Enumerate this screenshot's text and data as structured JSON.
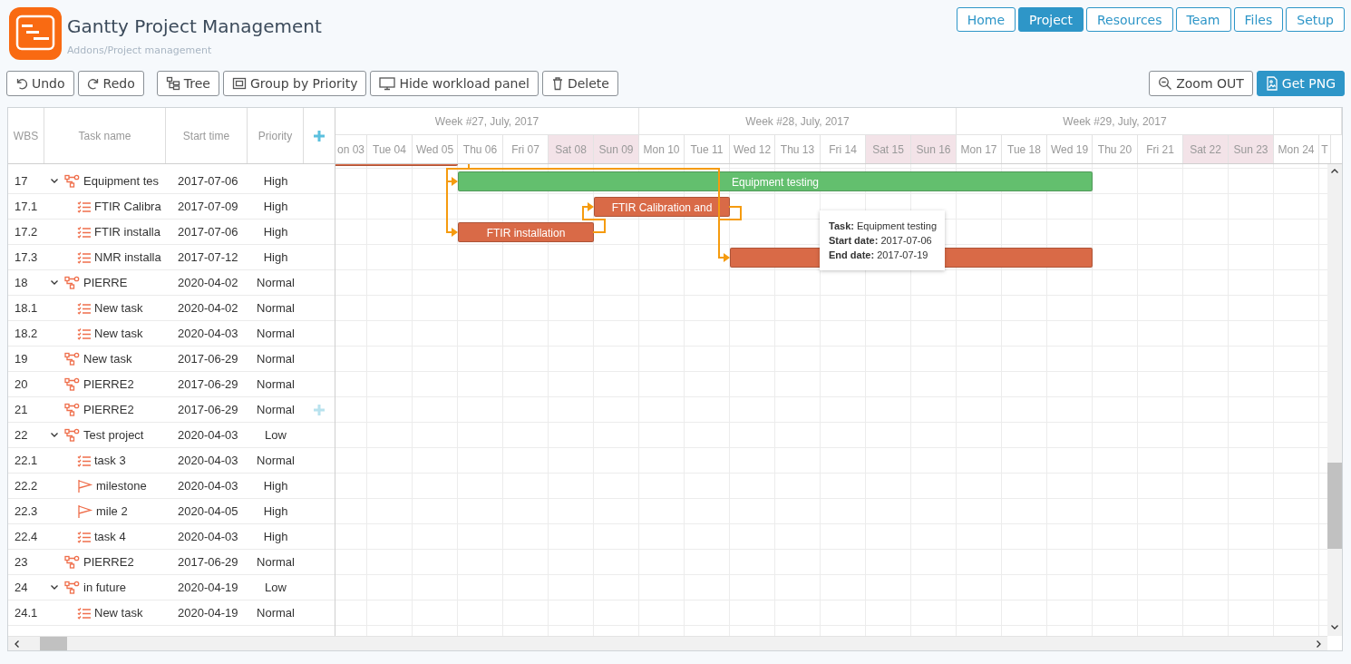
{
  "app": {
    "title": "Gantty Project Management",
    "breadcrumb": "Addons/Project management"
  },
  "nav": [
    {
      "label": "Home",
      "selected": false
    },
    {
      "label": "Project",
      "selected": true
    },
    {
      "label": "Resources",
      "selected": false
    },
    {
      "label": "Team",
      "selected": false
    },
    {
      "label": "Files",
      "selected": false
    },
    {
      "label": "Setup",
      "selected": false
    }
  ],
  "toolbar": {
    "left": [
      [
        {
          "label": "Undo"
        },
        {
          "label": "Redo"
        }
      ],
      [
        {
          "label": "Tree"
        },
        {
          "label": "Group by Priority"
        },
        {
          "label": "Hide workload panel"
        },
        {
          "label": "Delete"
        }
      ]
    ],
    "right": [
      {
        "label": "Zoom OUT",
        "primary": false
      },
      {
        "label": "Get PNG",
        "primary": true
      }
    ]
  },
  "grid": {
    "columns": [
      "WBS",
      "Task name",
      "Start time",
      "Priority"
    ],
    "rows": [
      {
        "wbs": "17",
        "name": "Equipment tes",
        "start": "2017-07-06",
        "priority": "High",
        "kind": "project",
        "expanded": true,
        "bar": {
          "label": "Equipment testing",
          "color": "#63bf6e"
        },
        "children": [
          {
            "wbs": "17.1",
            "name": "FTIR Calibra",
            "start": "2017-07-09",
            "priority": "High",
            "kind": "task",
            "bar": {
              "label": "FTIR Calibration and",
              "color": "#d96a47"
            }
          },
          {
            "wbs": "17.2",
            "name": "FTIR installa",
            "start": "2017-07-06",
            "priority": "High",
            "kind": "task",
            "bar": {
              "label": "FTIR installation",
              "color": "#d96a47"
            }
          },
          {
            "wbs": "17.3",
            "name": "NMR installa",
            "start": "2017-07-12",
            "priority": "High",
            "kind": "task",
            "bar": {
              "color": "#d96a47"
            }
          }
        ]
      },
      {
        "wbs": "18",
        "name": "PIERRE",
        "start": "2020-04-02",
        "priority": "Normal",
        "kind": "project",
        "expanded": true,
        "children": [
          {
            "wbs": "18.1",
            "name": "New task",
            "start": "2020-04-02",
            "priority": "Normal",
            "kind": "task"
          },
          {
            "wbs": "18.2",
            "name": "New task",
            "start": "2020-04-03",
            "priority": "Normal",
            "kind": "task"
          }
        ]
      },
      {
        "wbs": "19",
        "name": "New task",
        "start": "2017-06-29",
        "priority": "Normal",
        "kind": "project"
      },
      {
        "wbs": "20",
        "name": "PIERRE2",
        "start": "2017-06-29",
        "priority": "Normal",
        "kind": "project"
      },
      {
        "wbs": "21",
        "name": "PIERRE2",
        "start": "2017-06-29",
        "priority": "Normal",
        "kind": "project",
        "show_add": true
      },
      {
        "wbs": "22",
        "name": "Test project",
        "start": "2020-04-03",
        "priority": "Low",
        "kind": "project",
        "expanded": true,
        "children": [
          {
            "wbs": "22.1",
            "name": "task 3",
            "start": "2020-04-03",
            "priority": "Normal",
            "kind": "task"
          },
          {
            "wbs": "22.2",
            "name": "milestone",
            "start": "2020-04-03",
            "priority": "High",
            "kind": "milestone"
          },
          {
            "wbs": "22.3",
            "name": "mile 2",
            "start": "2020-04-05",
            "priority": "High",
            "kind": "milestone"
          },
          {
            "wbs": "22.4",
            "name": "task 4",
            "start": "2020-04-03",
            "priority": "High",
            "kind": "task"
          }
        ]
      },
      {
        "wbs": "23",
        "name": "PIERRE2",
        "start": "2017-06-29",
        "priority": "Normal",
        "kind": "project"
      },
      {
        "wbs": "24",
        "name": "in future",
        "start": "2020-04-19",
        "priority": "Low",
        "kind": "project",
        "expanded": true,
        "children": [
          {
            "wbs": "24.1",
            "name": "New task",
            "start": "2020-04-19",
            "priority": "Normal",
            "kind": "task"
          }
        ]
      }
    ]
  },
  "timeline": {
    "clipped_bar": {
      "color": "#d96a47"
    },
    "weeks": [
      {
        "label": "Week #27, July, 2017"
      },
      {
        "label": "Week #28, July, 2017"
      },
      {
        "label": "Week #29, July, 2017"
      }
    ],
    "days": [
      {
        "label": "on 03",
        "weekend": false
      },
      {
        "label": "Tue 04",
        "weekend": false
      },
      {
        "label": "Wed 05",
        "weekend": false
      },
      {
        "label": "Thu 06",
        "weekend": false
      },
      {
        "label": "Fri 07",
        "weekend": false
      },
      {
        "label": "Sat 08",
        "weekend": true
      },
      {
        "label": "Sun 09",
        "weekend": true
      },
      {
        "label": "Mon 10",
        "weekend": false
      },
      {
        "label": "Tue 11",
        "weekend": false
      },
      {
        "label": "Wed 12",
        "weekend": false
      },
      {
        "label": "Thu 13",
        "weekend": false
      },
      {
        "label": "Fri 14",
        "weekend": false
      },
      {
        "label": "Sat 15",
        "weekend": true
      },
      {
        "label": "Sun 16",
        "weekend": true
      },
      {
        "label": "Mon 17",
        "weekend": false
      },
      {
        "label": "Tue 18",
        "weekend": false
      },
      {
        "label": "Wed 19",
        "weekend": false
      },
      {
        "label": "Thu 20",
        "weekend": false
      },
      {
        "label": "Fri 21",
        "weekend": false
      },
      {
        "label": "Sat 22",
        "weekend": true
      },
      {
        "label": "Sun 23",
        "weekend": true
      },
      {
        "label": "Mon 24",
        "weekend": false
      },
      {
        "label": "T",
        "weekend": false
      }
    ],
    "tooltip": {
      "lines": [
        "**Task:** Equipment testing",
        "**Start date:** 2017-07-06",
        "**End date:** 2017-07-19"
      ]
    }
  }
}
